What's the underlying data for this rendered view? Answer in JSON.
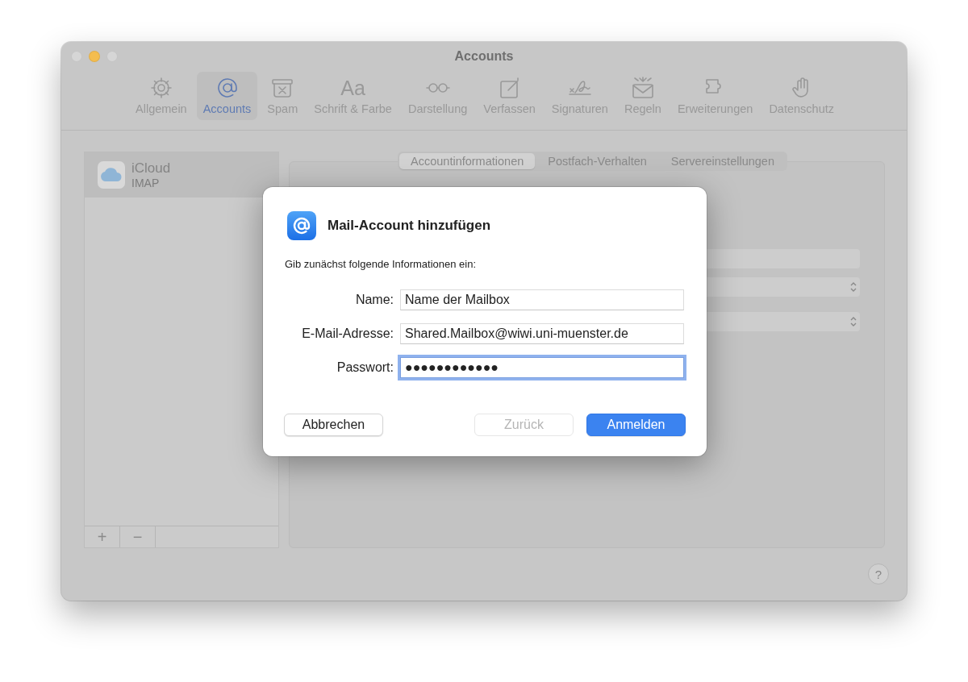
{
  "window": {
    "title": "Accounts",
    "controls": [
      {
        "color": "#d6d6d6"
      },
      {
        "color": "#f4bd4f"
      },
      {
        "color": "#d6d6d6"
      }
    ]
  },
  "toolbar": [
    {
      "label": "Allgemein",
      "selected": false
    },
    {
      "label": "Accounts",
      "selected": true
    },
    {
      "label": "Spam",
      "selected": false
    },
    {
      "label": "Schrift & Farbe",
      "selected": false,
      "glyph": "Aa"
    },
    {
      "label": "Darstellung",
      "selected": false
    },
    {
      "label": "Verfassen",
      "selected": false
    },
    {
      "label": "Signaturen",
      "selected": false
    },
    {
      "label": "Regeln",
      "selected": false
    },
    {
      "label": "Erweiterungen",
      "selected": false
    },
    {
      "label": "Datenschutz",
      "selected": false
    }
  ],
  "sidebar": {
    "accounts": [
      {
        "name": "iCloud",
        "type": "IMAP",
        "selected": true
      }
    ],
    "buttons": [
      "+",
      "−"
    ]
  },
  "tabs": [
    {
      "label": "Accountinformationen",
      "selected": true
    },
    {
      "label": "Postfach-Verhalten",
      "selected": false
    },
    {
      "label": "Servereinstellungen",
      "selected": false
    }
  ],
  "help": "?",
  "dialog": {
    "title": "Mail-Account hinzufügen",
    "prompt": "Gib zunächst folgende Informationen ein:",
    "fields": [
      {
        "label": "Name:",
        "value": "Name der Mailbox",
        "focused": false
      },
      {
        "label": "E-Mail-Adresse:",
        "value": "Shared.Mailbox@wiwi.uni-muenster.de",
        "focused": false
      },
      {
        "label": "Passwort:",
        "value": "●●●●●●●●●●●●",
        "focused": true
      }
    ],
    "buttons": [
      {
        "label": "Abbrechen",
        "kind": "cancel",
        "disabled": false
      },
      {
        "label": "Zurück",
        "kind": "back",
        "disabled": true
      },
      {
        "label": "Anmelden",
        "kind": "default",
        "disabled": false
      }
    ]
  }
}
